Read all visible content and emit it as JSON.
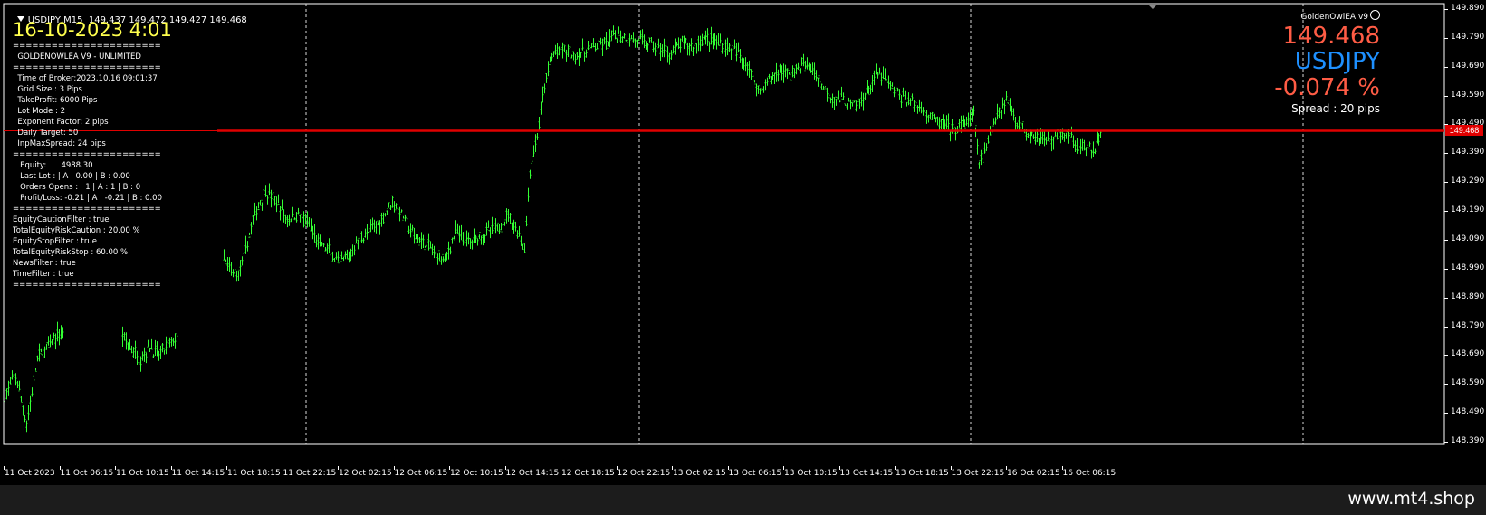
{
  "header": {
    "symbol_line": "USDJPY,M15  149.437 149.472 149.427 149.468"
  },
  "panel": {
    "datetime": "16-10-2023 4:01",
    "lines": [
      "=======================",
      "  GOLDENOWLEA V9 - UNLIMITED",
      "=======================",
      "  Time of Broker:2023.10.16 09:01:37",
      "  Grid Size : 3 Pips",
      "  TakeProfit: 6000 Pips",
      "  Lot Mode : 2",
      "  Exponent Factor: 2 pips",
      "  Daily Target: 50",
      "  InpMaxSpread: 24 pips",
      "=======================",
      "   Equity:      4988.30",
      "   Last Lot : | A : 0.00 | B : 0.00",
      "   Orders Opens :   1 | A : 1 | B : 0",
      "   Profit/Loss: -0.21 | A : -0.21 | B : 0.00",
      "=======================",
      "EquityCautionFilter : true",
      "TotalEquityRiskCaution : 20.00 %",
      "EquityStopFilter : true",
      "TotalEquityRiskStop : 60.00 %",
      "NewsFilter : true",
      "TimeFilter : true",
      "======================="
    ]
  },
  "right_info": {
    "ea_name": "GoldenOwlEA v9",
    "price": "149.468",
    "symbol": "USDJPY",
    "change": "-0.074 %",
    "spread": "Spread : 20 pips"
  },
  "price_axis": {
    "labels": [
      "149.890",
      "149.790",
      "149.690",
      "149.590",
      "149.490",
      "149.390",
      "149.290",
      "149.190",
      "149.090",
      "148.990",
      "148.890",
      "148.790",
      "148.690",
      "148.590",
      "148.490",
      "148.390"
    ],
    "current_price_label": "149.468"
  },
  "time_axis": {
    "labels": [
      "11 Oct 2023",
      "11 Oct 06:15",
      "11 Oct 10:15",
      "11 Oct 14:15",
      "11 Oct 18:15",
      "11 Oct 22:15",
      "12 Oct 02:15",
      "12 Oct 06:15",
      "12 Oct 10:15",
      "12 Oct 14:15",
      "12 Oct 18:15",
      "12 Oct 22:15",
      "13 Oct 02:15",
      "13 Oct 06:15",
      "13 Oct 10:15",
      "13 Oct 14:15",
      "13 Oct 18:15",
      "13 Oct 22:15",
      "16 Oct 02:15",
      "16 Oct 06:15"
    ]
  },
  "chart_data": {
    "type": "bar",
    "symbol": "USDJPY",
    "timeframe": "M15",
    "ylim": [
      148.39,
      149.89
    ],
    "current_price": 149.468,
    "price_path": [
      [
        0,
        148.55
      ],
      [
        12,
        148.62
      ],
      [
        24,
        148.45
      ],
      [
        36,
        148.68
      ],
      [
        48,
        148.72
      ],
      [
        58,
        148.76
      ],
      [
        65,
        148.77
      ],
      [
        130,
        148.76
      ],
      [
        140,
        148.71
      ],
      [
        150,
        148.68
      ],
      [
        160,
        148.72
      ],
      [
        170,
        148.69
      ],
      [
        180,
        148.72
      ],
      [
        192,
        148.76
      ],
      [
        242,
        149.02
      ],
      [
        250,
        148.98
      ],
      [
        258,
        148.97
      ],
      [
        266,
        149.06
      ],
      [
        276,
        149.18
      ],
      [
        288,
        149.26
      ],
      [
        300,
        149.22
      ],
      [
        312,
        149.16
      ],
      [
        324,
        149.18
      ],
      [
        336,
        149.14
      ],
      [
        346,
        149.08
      ],
      [
        358,
        149.05
      ],
      [
        368,
        149.01
      ],
      [
        380,
        149.03
      ],
      [
        392,
        149.1
      ],
      [
        404,
        149.12
      ],
      [
        416,
        149.16
      ],
      [
        428,
        149.23
      ],
      [
        440,
        149.17
      ],
      [
        452,
        149.1
      ],
      [
        464,
        149.08
      ],
      [
        474,
        149.05
      ],
      [
        486,
        149.02
      ],
      [
        498,
        149.12
      ],
      [
        510,
        149.08
      ],
      [
        522,
        149.1
      ],
      [
        534,
        149.12
      ],
      [
        546,
        149.13
      ],
      [
        556,
        149.18
      ],
      [
        566,
        149.12
      ],
      [
        574,
        149.06
      ],
      [
        580,
        149.33
      ],
      [
        588,
        149.45
      ],
      [
        596,
        149.62
      ],
      [
        604,
        149.73
      ],
      [
        616,
        149.75
      ],
      [
        628,
        149.73
      ],
      [
        640,
        149.74
      ],
      [
        652,
        149.76
      ],
      [
        664,
        149.77
      ],
      [
        676,
        149.8
      ],
      [
        688,
        149.79
      ],
      [
        700,
        149.78
      ],
      [
        712,
        149.77
      ],
      [
        724,
        149.75
      ],
      [
        736,
        149.74
      ],
      [
        748,
        149.77
      ],
      [
        760,
        149.76
      ],
      [
        772,
        149.79
      ],
      [
        784,
        149.78
      ],
      [
        796,
        149.76
      ],
      [
        808,
        149.74
      ],
      [
        820,
        149.7
      ],
      [
        832,
        149.61
      ],
      [
        844,
        149.64
      ],
      [
        856,
        149.68
      ],
      [
        868,
        149.66
      ],
      [
        880,
        149.7
      ],
      [
        892,
        149.68
      ],
      [
        904,
        149.62
      ],
      [
        916,
        149.58
      ],
      [
        928,
        149.57
      ],
      [
        940,
        149.55
      ],
      [
        952,
        149.6
      ],
      [
        964,
        149.67
      ],
      [
        976,
        149.63
      ],
      [
        988,
        149.59
      ],
      [
        1000,
        149.57
      ],
      [
        1012,
        149.55
      ],
      [
        1024,
        149.51
      ],
      [
        1036,
        149.49
      ],
      [
        1048,
        149.47
      ],
      [
        1060,
        149.49
      ],
      [
        1070,
        149.52
      ],
      [
        1076,
        149.36
      ],
      [
        1084,
        149.4
      ],
      [
        1094,
        149.52
      ],
      [
        1106,
        149.58
      ],
      [
        1118,
        149.5
      ],
      [
        1130,
        149.46
      ],
      [
        1142,
        149.45
      ],
      [
        1154,
        149.43
      ],
      [
        1166,
        149.46
      ],
      [
        1178,
        149.44
      ],
      [
        1190,
        149.41
      ],
      [
        1202,
        149.4
      ],
      [
        1212,
        149.46
      ]
    ]
  }
}
